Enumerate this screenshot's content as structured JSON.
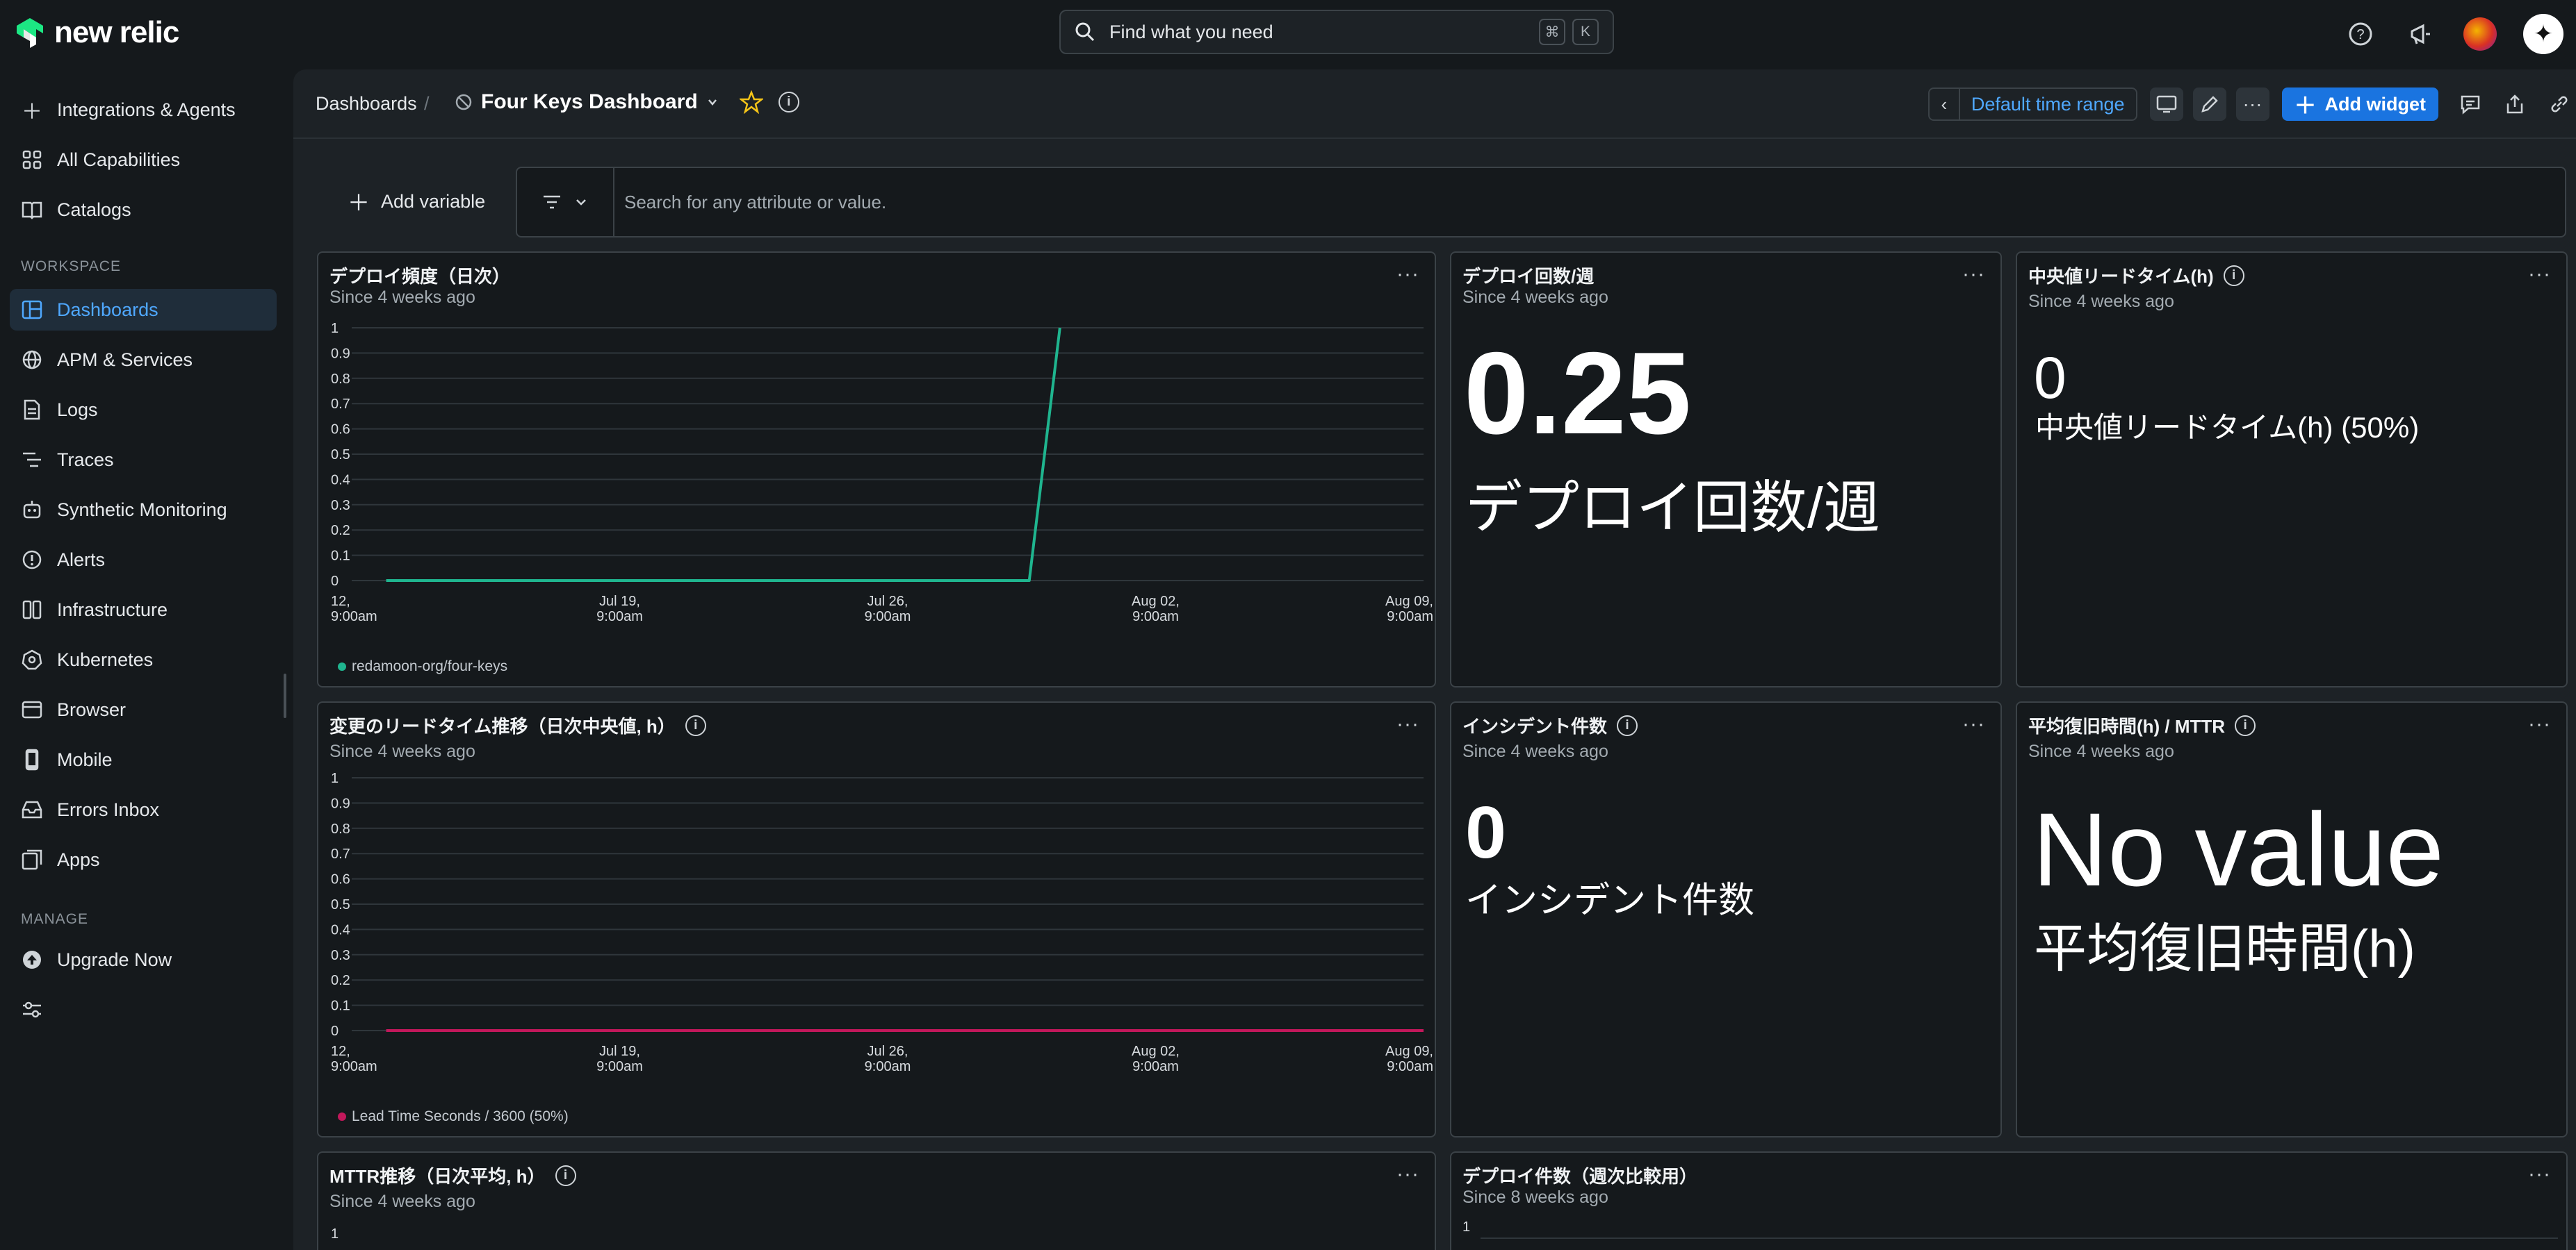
{
  "app": {
    "logo_text": "new relic"
  },
  "search": {
    "placeholder": "Find what you need",
    "kbd1": "⌘",
    "kbd2": "K"
  },
  "sidebar": {
    "items": [
      {
        "label": "Integrations & Agents",
        "icon": "plus-icon"
      },
      {
        "label": "All Capabilities",
        "icon": "grid-icon"
      },
      {
        "label": "Catalogs",
        "icon": "book-icon"
      }
    ],
    "workspace_label": "WORKSPACE",
    "workspace_items": [
      {
        "label": "Dashboards",
        "icon": "dashboard-icon",
        "active": true
      },
      {
        "label": "APM & Services",
        "icon": "globe-icon"
      },
      {
        "label": "Logs",
        "icon": "logs-icon"
      },
      {
        "label": "Traces",
        "icon": "traces-icon"
      },
      {
        "label": "Synthetic Monitoring",
        "icon": "robot-icon"
      },
      {
        "label": "Alerts",
        "icon": "alert-icon"
      },
      {
        "label": "Infrastructure",
        "icon": "infrastructure-icon"
      },
      {
        "label": "Kubernetes",
        "icon": "kubernetes-icon"
      },
      {
        "label": "Browser",
        "icon": "browser-icon"
      },
      {
        "label": "Mobile",
        "icon": "mobile-icon"
      },
      {
        "label": "Errors Inbox",
        "icon": "inbox-icon"
      },
      {
        "label": "Apps",
        "icon": "apps-icon"
      }
    ],
    "manage_label": "MANAGE",
    "manage_items": [
      {
        "label": "Upgrade Now",
        "icon": "upgrade-icon"
      }
    ]
  },
  "header": {
    "breadcrumb": "Dashboards",
    "separator": "/",
    "title": "Four Keys Dashboard",
    "time_range": "Default time range",
    "add_widget": "Add widget"
  },
  "variables": {
    "add_label": "Add variable",
    "filter_placeholder": "Search for any attribute or value."
  },
  "widgets": {
    "deploy_freq": {
      "title": "デプロイ頻度（日次）",
      "subtitle": "Since 4 weeks ago",
      "legend": "redamoon-org/four-keys"
    },
    "deploy_per_week": {
      "title": "デプロイ回数/週",
      "subtitle": "Since 4 weeks ago",
      "value": "0.25",
      "label": "デプロイ回数/週"
    },
    "median_lead": {
      "title": "中央値リードタイム(h)",
      "subtitle": "Since 4 weeks ago",
      "value": "0",
      "label": "中央値リードタイム(h) (50%)"
    },
    "lead_trend": {
      "title": "変更のリードタイム推移（日次中央値, h）",
      "subtitle": "Since 4 weeks ago",
      "legend": "Lead Time Seconds / 3600 (50%)"
    },
    "incidents": {
      "title": "インシデント件数",
      "subtitle": "Since 4 weeks ago",
      "value": "0",
      "label": "インシデント件数"
    },
    "mttr": {
      "title": "平均復旧時間(h) / MTTR",
      "subtitle": "Since 4 weeks ago",
      "value": "No value",
      "label": "平均復旧時間(h)"
    },
    "mttr_trend": {
      "title": "MTTR推移（日次平均, h）",
      "subtitle": "Since 4 weeks ago",
      "y_top": "1"
    },
    "deploy_weekly": {
      "title": "デプロイ件数（週次比較用）",
      "subtitle": "Since 8 weeks ago",
      "y_top": "1"
    },
    "menu": "···"
  },
  "chart_data": [
    {
      "type": "line",
      "title": "デプロイ頻度（日次）",
      "x_ticks": [
        "12,\n9:00am",
        "Jul 19,\n9:00am",
        "Jul 26,\n9:00am",
        "Aug 02,\n9:00am",
        "Aug 09,\n9:00am"
      ],
      "y_ticks": [
        "0",
        "0.1",
        "0.2",
        "0.3",
        "0.4",
        "0.5",
        "0.6",
        "0.7",
        "0.8",
        "0.9",
        "1"
      ],
      "ylim": [
        0,
        1
      ],
      "xlim": [
        0,
        28
      ],
      "series": [
        {
          "name": "redamoon-org/four-keys",
          "color": "#1fb58f",
          "x": [
            0.9,
            17.7,
            18.5
          ],
          "y": [
            0,
            0,
            1
          ]
        }
      ],
      "grid": true
    },
    {
      "type": "line",
      "title": "変更のリードタイム推移（日次中央値, h）",
      "x_ticks": [
        "12,\n9:00am",
        "Jul 19,\n9:00am",
        "Jul 26,\n9:00am",
        "Aug 02,\n9:00am",
        "Aug 09,\n9:00am"
      ],
      "y_ticks": [
        "0",
        "0.1",
        "0.2",
        "0.3",
        "0.4",
        "0.5",
        "0.6",
        "0.7",
        "0.8",
        "0.9",
        "1"
      ],
      "ylim": [
        0,
        1
      ],
      "xlim": [
        0,
        28
      ],
      "series": [
        {
          "name": "Lead Time Seconds / 3600 (50%)",
          "color": "#c2185b",
          "x": [
            0.9,
            28
          ],
          "y": [
            0,
            0
          ]
        }
      ],
      "grid": true
    }
  ]
}
